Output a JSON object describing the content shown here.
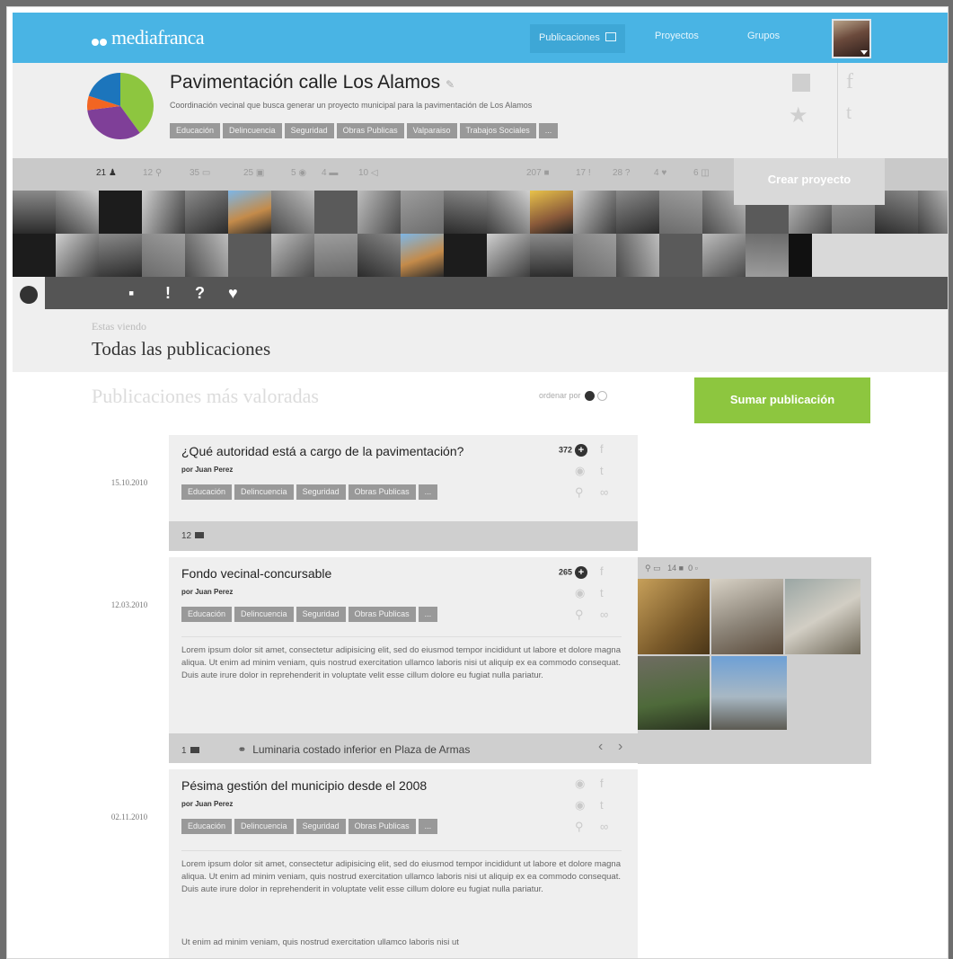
{
  "brand": {
    "logo": "mediafranca"
  },
  "nav": {
    "items": [
      "Publicaciones",
      "Proyectos",
      "Grupos"
    ]
  },
  "project": {
    "title": "Pavimentación calle Los Alamos",
    "description": "Coordinación vecinal que busca generar un proyecto municipal para la pavimentación de Los Alamos",
    "tags": [
      "Educación",
      "Delincuencia",
      "Seguridad",
      "Obras Publicas",
      "Valparaiso",
      "Trabajos Sociales",
      "..."
    ],
    "pie": [
      {
        "color": "#8dc63f",
        "value": 0.4
      },
      {
        "color": "#7f3f98",
        "value": 0.33
      },
      {
        "color": "#f26522",
        "value": 0.07
      },
      {
        "color": "#1c75bc",
        "value": 0.2
      }
    ]
  },
  "stats": {
    "left": [
      "21",
      "12",
      "35",
      "25",
      "5",
      "4",
      "10"
    ],
    "right": [
      "207",
      "17",
      "28",
      "4",
      "6"
    ],
    "create_button": "Crear proyecto"
  },
  "filters": [
    "●",
    "▪",
    "!",
    "?",
    "♥"
  ],
  "viewing": {
    "label": "Estas viendo",
    "title": "Todas las publicaciones"
  },
  "list": {
    "title": "Publicaciones más valoradas",
    "order_label": "ordenar por",
    "add_button": "Sumar publicación"
  },
  "posts": [
    {
      "type_symbol": "?",
      "type_color": "#8b3f9c",
      "date": "15.10.2010",
      "title": "¿Qué autoridad está a cargo de la pavimentación?",
      "author": "por Juan Perez",
      "votes": "372",
      "tags": [
        "Educación",
        "Delincuencia",
        "Seguridad",
        "Obras Publicas",
        "..."
      ],
      "comments": "12"
    },
    {
      "type_symbol": "●",
      "type_color": "#6db33f",
      "date": "12.03.2010",
      "title": "Fondo vecinal-concursable",
      "author": "por Juan Perez",
      "votes": "265",
      "tags": [
        "Educación",
        "Delincuencia",
        "Seguridad",
        "Obras Publicas",
        "..."
      ],
      "body": "Lorem ipsum dolor sit amet, consectetur adipisicing elit, sed do eiusmod tempor incididunt ut labore et dolore magna aliqua. Ut enim ad minim veniam, quis nostrud exercitation ullamco laboris nisi ut aliquip ex ea commodo consequat. Duis aute irure dolor in reprehenderit in voluptate velit esse cillum dolore eu fugiat nulla pariatur.",
      "comments": "1",
      "link_text": "Luminaria costado inferior en Plaza de Armas",
      "gallery": {
        "photos": "14",
        "videos": "0"
      }
    },
    {
      "type_symbol": "▪",
      "type_color": "#0a3d9c",
      "date": "02.11.2010",
      "title": "Pésima gestión del municipio desde el 2008",
      "author": "por Juan Perez",
      "tags": [
        "Educación",
        "Delincuencia",
        "Seguridad",
        "Obras Publicas",
        "..."
      ],
      "body": "Lorem ipsum dolor sit amet, consectetur adipisicing elit, sed do eiusmod tempor incididunt ut labore et dolore magna aliqua. Ut enim ad minim veniam, quis nostrud exercitation ullamco laboris nisi ut aliquip ex ea commodo consequat. Duis aute irure dolor in reprehenderit in voluptate velit esse cillum dolore eu fugiat nulla pariatur.",
      "body2": "Ut enim ad minim veniam, quis nostrud exercitation ullamco laboris nisi ut"
    }
  ]
}
